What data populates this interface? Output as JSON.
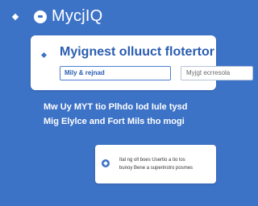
{
  "header": {
    "app_title": "MycjIQ"
  },
  "card": {
    "title": "Myignest olluuct flotertor",
    "field_primary_value": "Mily & rejnad",
    "field_secondary_value": "Myjgt ecrresola"
  },
  "description": {
    "line1": "Mw Uy MYT tio Plhdo lod Iule tysd",
    "line2": "Mig Elylce and Fort Mils tho mogi"
  },
  "notice": {
    "line1": "Ital ng oll boes Usertio a tio los",
    "line2": "bunoy Bene a superinstro posmes"
  },
  "colors": {
    "background": "#3d73c7",
    "accent": "#2a5db0",
    "card": "#ffffff"
  },
  "icons": {
    "menu": "diamond-icon",
    "logo": "logo-circle-icon",
    "card_bullet": "diamond-icon",
    "notice": "info-diamond-icon"
  }
}
